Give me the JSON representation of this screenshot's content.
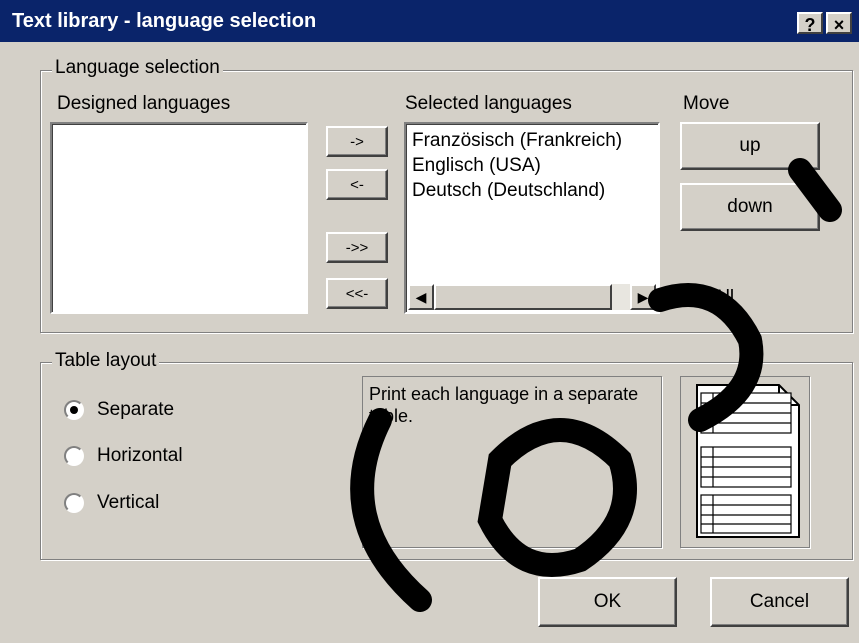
{
  "window": {
    "title": "Text library - language selection",
    "help_label": "?",
    "close_label": "×"
  },
  "language_selection": {
    "legend": "Language selection",
    "designed_label": "Designed languages",
    "selected_label": "Selected languages",
    "move_label": "Move",
    "designed_items": [],
    "selected_items": [
      "Französisch (Frankreich)",
      "Englisch (USA)",
      "Deutsch (Deutschland)"
    ],
    "add_label": "->",
    "remove_label": "<-",
    "add_all_label": "->>",
    "remove_all_label": "<<-",
    "up_label": "up",
    "down_label": "down",
    "all_label": "All",
    "all_checked": true,
    "scroll_left_icon": "◀",
    "scroll_right_icon": "▶"
  },
  "table_layout": {
    "legend": "Table layout",
    "options": [
      "Separate",
      "Horizontal",
      "Vertical"
    ],
    "selected": "Separate",
    "description": "Print each language in a separate table."
  },
  "footer": {
    "ok_label": "OK",
    "cancel_label": "Cancel"
  }
}
